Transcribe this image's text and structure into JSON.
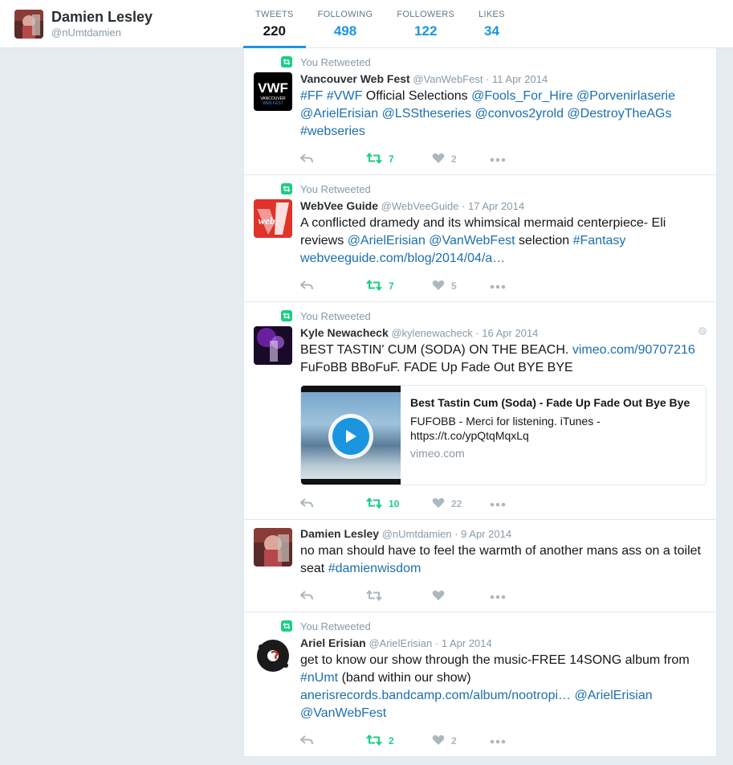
{
  "profile": {
    "name": "Damien Lesley",
    "handle": "@nUmtdamien"
  },
  "stats": [
    {
      "label": "TWEETS",
      "value": "220",
      "active": true
    },
    {
      "label": "FOLLOWING",
      "value": "498"
    },
    {
      "label": "FOLLOWERS",
      "value": "122"
    },
    {
      "label": "LIKES",
      "value": "34"
    }
  ],
  "context_label": "You Retweeted",
  "tweets": [
    {
      "name": "Vancouver Web Fest",
      "handle": "@VanWebFest",
      "date": "· 11 Apr 2014",
      "text": [
        [
          "#FF #VWF",
          true
        ],
        [
          " Official Selections ",
          false
        ],
        [
          "@Fools_For_Hire @Porvenirlaserie @ArielErisian @LSStheseries @convos2yrold @DestroyTheAGs #webseries",
          true
        ]
      ],
      "retweets": "7",
      "likes": "2"
    },
    {
      "name": "WebVee Guide",
      "handle": "@WebVeeGuide",
      "date": "· 17 Apr 2014",
      "text": [
        [
          "A conflicted dramedy and its whimsical mermaid centerpiece- Eli reviews ",
          false
        ],
        [
          "@ArielErisian @VanWebFest",
          true
        ],
        [
          " selection ",
          false
        ],
        [
          "#Fantasy",
          true
        ],
        [
          " ",
          false
        ],
        [
          "webveeguide.com/blog/2014/04/a…",
          true
        ]
      ],
      "retweets": "7",
      "likes": "5"
    },
    {
      "name": "Kyle Newacheck",
      "handle": "@kylenewacheck",
      "date": "· 16 Apr 2014",
      "text": [
        [
          "BEST TASTIN' CUM (SODA) ON THE BEACH. ",
          false
        ],
        [
          "vimeo.com/90707216",
          true
        ],
        [
          " FuFoBB BBoFuF.  FADE Up Fade Out BYE BYE",
          false
        ]
      ],
      "card": {
        "title": "Best Tastin Cum (Soda) - Fade Up Fade Out Bye Bye",
        "desc": "FUFOBB - Merci for listening. iTunes - https://t.co/ypQtqMqxLq",
        "domain": "vimeo.com"
      },
      "retweets": "10",
      "likes": "22"
    },
    {
      "name": "Damien Lesley",
      "handle": "@nUmtdamien",
      "date": "· 9 Apr 2014",
      "text": [
        [
          "no man should have to feel the warmth of another mans ass on a toilet seat ",
          false
        ],
        [
          "#damienwisdom",
          true
        ]
      ],
      "retweets": "",
      "likes": ""
    },
    {
      "name": "Ariel Erisian",
      "handle": "@ArielErisian",
      "date": "· 1 Apr 2014",
      "text": [
        [
          "get to know our show through the music-FREE 14SONG album from ",
          false
        ],
        [
          "#nUmt",
          true
        ],
        [
          " (band within our show) ",
          false
        ],
        [
          "anerisrecords.bandcamp.com/album/nootropi… @ArielErisian @VanWebFest",
          true
        ]
      ],
      "retweets": "2",
      "likes": "2"
    }
  ],
  "colors": {
    "accent": "#1b95e0",
    "retweet_green": "#19cf86",
    "link": "#1b6fae"
  }
}
